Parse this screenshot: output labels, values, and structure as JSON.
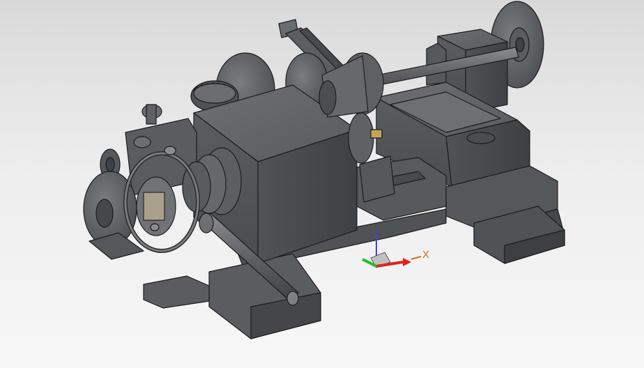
{
  "viewport": {
    "background_top": "#d9d9d9",
    "background_bottom": "#f7f7f7"
  },
  "model": {
    "body_color": "#5f6264",
    "edge_color": "#1c1c1c",
    "highlight_color": "#8a8d8f",
    "shadow_color": "#45484a",
    "brass_color": "#c7a35a"
  },
  "triad": {
    "x_label": "X",
    "x_color": "#e02020",
    "y_color": "#20c020",
    "z_color": "#4040e0",
    "label_color": "#c87020"
  },
  "icons": [
    "view-triad-icon"
  ]
}
